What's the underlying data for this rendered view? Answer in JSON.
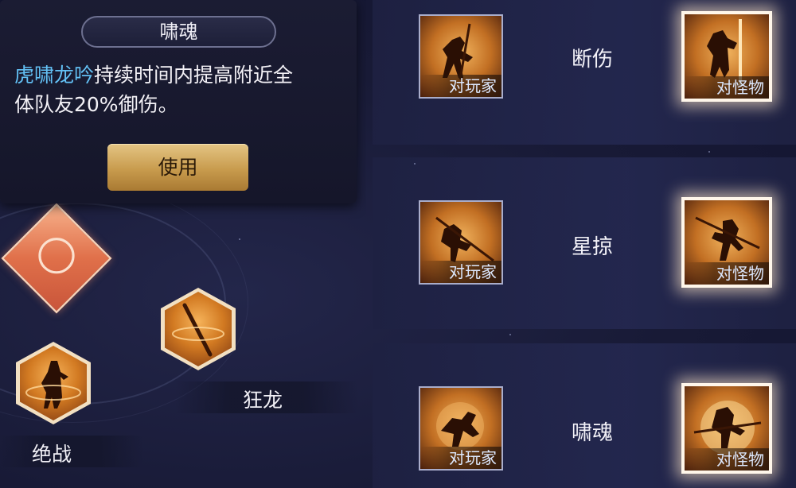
{
  "tooltip": {
    "title": "啸魂",
    "desc_highlight": "虎啸龙吟",
    "desc_line1_rest": "持续时间内提高附近全",
    "desc_line2": "体队友20%御伤。",
    "use_label": "使用"
  },
  "left_skills": {
    "skill_kuanglong": "狂龙",
    "skill_juezhan": "绝战"
  },
  "rows": [
    {
      "name": "断伤",
      "player_tag": "对玩家",
      "monster_tag": "对怪物"
    },
    {
      "name": "星掠",
      "player_tag": "对玩家",
      "monster_tag": "对怪物"
    },
    {
      "name": "啸魂",
      "player_tag": "对玩家",
      "monster_tag": "对怪物"
    }
  ],
  "colors": {
    "highlight_text": "#63c1f5",
    "use_button_gold": "#c89b4d",
    "card_orange": "#d27a22"
  }
}
